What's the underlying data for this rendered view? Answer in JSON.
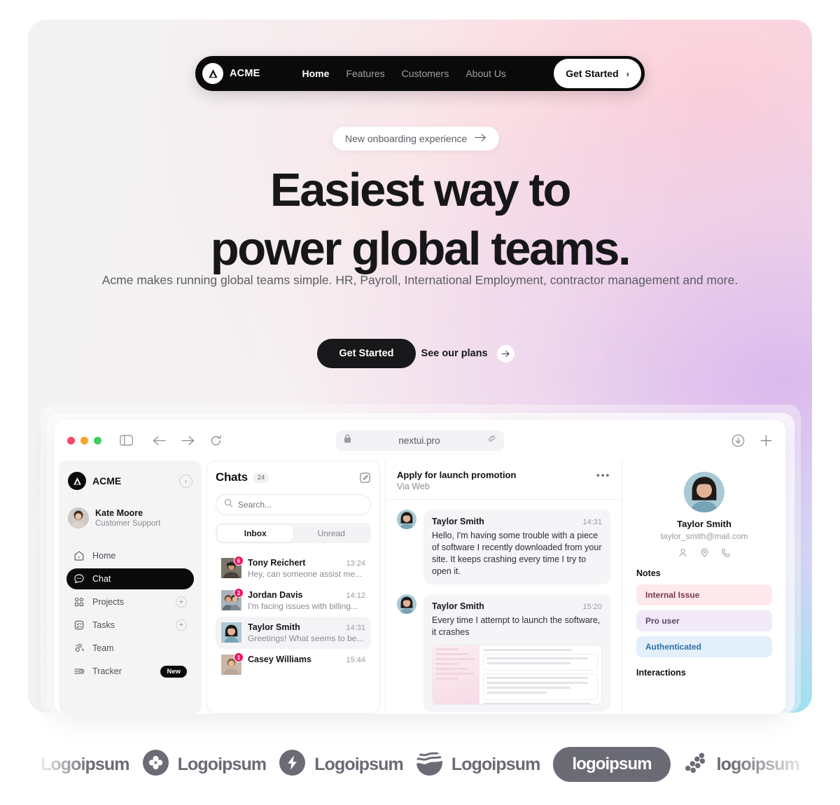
{
  "brand": {
    "name": "ACME",
    "logo_icon": "acme-triangle-logo"
  },
  "nav": {
    "links": [
      {
        "label": "Home",
        "active": true
      },
      {
        "label": "Features",
        "active": false
      },
      {
        "label": "Customers",
        "active": false
      },
      {
        "label": "About Us",
        "active": false
      }
    ],
    "cta_label": "Get Started",
    "cta_chevron": "›"
  },
  "hero": {
    "announcement": "New onboarding experience",
    "announcement_arrow": "→",
    "headline_line1": "Easiest way to",
    "headline_line2": "power global teams.",
    "subhead": "Acme makes running global teams simple. HR, Payroll, International Employment, contractor management and more.",
    "primary_cta": "Get Started",
    "secondary_cta": "See our plans",
    "secondary_arrow": "→"
  },
  "browser": {
    "url": "nextui.pro",
    "lock_icon": "lock-icon",
    "link_icon": "link-icon",
    "traffic_lights": [
      "close-red",
      "minimize-yellow",
      "maximize-green"
    ],
    "download_icon": "download-circle-icon",
    "newtab_icon": "plus-icon"
  },
  "app": {
    "sidebar": {
      "brand": "ACME",
      "collapse_icon": "chevron-left-circle-icon",
      "user": {
        "name": "Kate Moore",
        "role": "Customer Support"
      },
      "items": [
        {
          "label": "Home",
          "icon": "home-icon",
          "selected": false,
          "action": null,
          "badge": null
        },
        {
          "label": "Chat",
          "icon": "chat-bubble-icon",
          "selected": true,
          "action": null,
          "badge": null
        },
        {
          "label": "Projects",
          "icon": "grid-icon",
          "selected": false,
          "action": "+",
          "badge": null
        },
        {
          "label": "Tasks",
          "icon": "checklist-icon",
          "selected": false,
          "action": "+",
          "badge": null
        },
        {
          "label": "Team",
          "icon": "people-icon",
          "selected": false,
          "action": null,
          "badge": null
        },
        {
          "label": "Tracker",
          "icon": "tracker-clock-icon",
          "selected": false,
          "action": null,
          "badge": "New"
        }
      ]
    },
    "chatlist": {
      "title": "Chats",
      "count": "24",
      "compose_icon": "compose-edit-icon",
      "search_placeholder": "Search...",
      "search_value": "",
      "search_icon": "search-icon",
      "tabs": [
        {
          "label": "Inbox",
          "selected": true
        },
        {
          "label": "Unread",
          "selected": false
        }
      ],
      "rows": [
        {
          "name": "Tony Reichert",
          "time": "13:24",
          "snippet": "Hey, can someone assist me...",
          "badge": "6",
          "selected": false
        },
        {
          "name": "Jordan Davis",
          "time": "14:12",
          "snippet": "I'm facing issues with billing...",
          "badge": "2",
          "selected": false
        },
        {
          "name": "Taylor Smith",
          "time": "14:31",
          "snippet": "Greetings! What seems to be...",
          "badge": null,
          "selected": true
        },
        {
          "name": "Casey Williams",
          "time": "15:44",
          "snippet": "",
          "badge": "1",
          "selected": false
        }
      ]
    },
    "thread": {
      "title": "Apply for launch promotion",
      "subtitle": "Via Web",
      "more_icon": "more-horizontal-icon",
      "messages": [
        {
          "sender": "Taylor Smith",
          "time": "14:31",
          "text": "Hello, I'm having some trouble with a piece of software I recently downloaded from your site. It keeps crashing every time I try to open it.",
          "attachment": false
        },
        {
          "sender": "Taylor Smith",
          "time": "15:20",
          "text": "Every time I attempt to launch the software, it crashes",
          "attachment": true
        }
      ]
    },
    "profile": {
      "name": "Taylor Smith",
      "email": "taylor_smith@mail.com",
      "action_icons": [
        "user-icon",
        "location-pin-icon",
        "phone-icon"
      ],
      "notes_heading": "Notes",
      "notes": [
        {
          "label": "Internal Issue",
          "bg": "#fde8ec",
          "fg": "#7c3a4a"
        },
        {
          "label": "Pro user",
          "bg": "#f1e9f7",
          "fg": "#5b4a68"
        },
        {
          "label": "Authenticated",
          "bg": "#e3effa",
          "fg": "#2f6fa8"
        }
      ],
      "interactions_heading": "Interactions"
    }
  },
  "logos": [
    {
      "text": "Logoipsum",
      "mark": "none",
      "fade": "left"
    },
    {
      "text": "Logoipsum",
      "mark": "clover-icon",
      "fade": "none"
    },
    {
      "text": "Logoipsum",
      "mark": "bolt-icon",
      "fade": "none"
    },
    {
      "text": "Logoipsum",
      "mark": "wave-globe-icon",
      "fade": "none"
    },
    {
      "text": "logoipsum",
      "mark": "pill",
      "fade": "none"
    },
    {
      "text": "logoipsum",
      "mark": "dots-diagonal-icon",
      "fade": "right"
    }
  ],
  "colors": {
    "ink": "#0a0a0a",
    "accent_pink": "#f31260",
    "gradient_from": "#f3f2f2",
    "gradient_mid": "#f6e7ee",
    "gradient_to": "#dcdff0"
  }
}
